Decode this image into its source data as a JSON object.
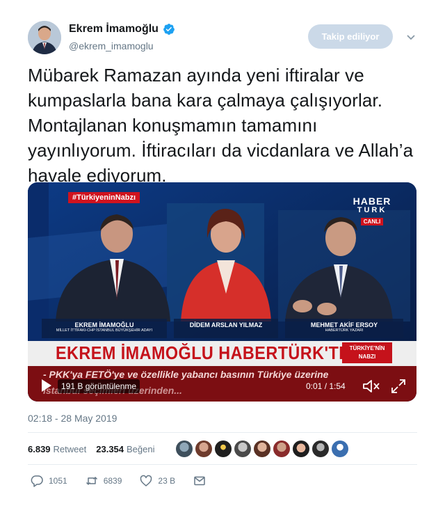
{
  "user": {
    "name": "Ekrem İmamoğlu",
    "handle": "@ekrem_imamoglu",
    "follow_label": "Takip ediliyor"
  },
  "tweet": {
    "text": "Mübarek Ramazan ayında yeni iftiralar ve kumpaslarla bana kara çalmaya çalışıyorlar. Montajlanan konuşmamın tamamını yayınlıyorum. İftiracıları da vicdanlara ve Allah’a havale ediyorum.",
    "timestamp": "02:18 - 28 May 2019"
  },
  "video": {
    "hashtag": "#TürkiyeninNabzı",
    "logo_line1": "HABER",
    "logo_line2": "TURK",
    "logo_live": "CANLI",
    "guests": [
      {
        "name": "EKREM İMAMOĞLU",
        "role": "MİLLET İTTİFAKI-CHP İSTANBUL BÜYÜKŞEHİR ADAYI"
      },
      {
        "name": "DİDEM ARSLAN YILMAZ",
        "role": ""
      },
      {
        "name": "MEHMET AKİF ERSOY",
        "role": "HABERTÜRK YAZARI"
      }
    ],
    "headline": "EKREM İMAMOĞLU HABERTÜRK'TE",
    "program_tag_line1": "TÜRKİYE'NİN",
    "program_tag_line2": "NABZI",
    "ticker_line1": "- PKK'ya FETÖ'ye ve özellikle yabancı basının Türkiye üzerine",
    "ticker_line2": "İstanbul seçimleri üzerinden...",
    "views": "191 B görüntülenme",
    "time": "0:01 / 1:54"
  },
  "stats": {
    "retweet_count": "6.839",
    "retweet_label": "Retweet",
    "like_count": "23.354",
    "like_label": "Beğeni"
  },
  "likers": [
    "avatar-1",
    "avatar-2",
    "avatar-3",
    "avatar-4",
    "avatar-5",
    "avatar-6",
    "avatar-7",
    "avatar-8",
    "avatar-9"
  ],
  "actions": {
    "reply_count": "1051",
    "retweet_count": "6839",
    "like_count": "23 B"
  },
  "colors": {
    "verified": "#1da1f2",
    "muted": "#657786",
    "follow_bg": "#cbd9e8",
    "brand_red": "#d0131e"
  }
}
